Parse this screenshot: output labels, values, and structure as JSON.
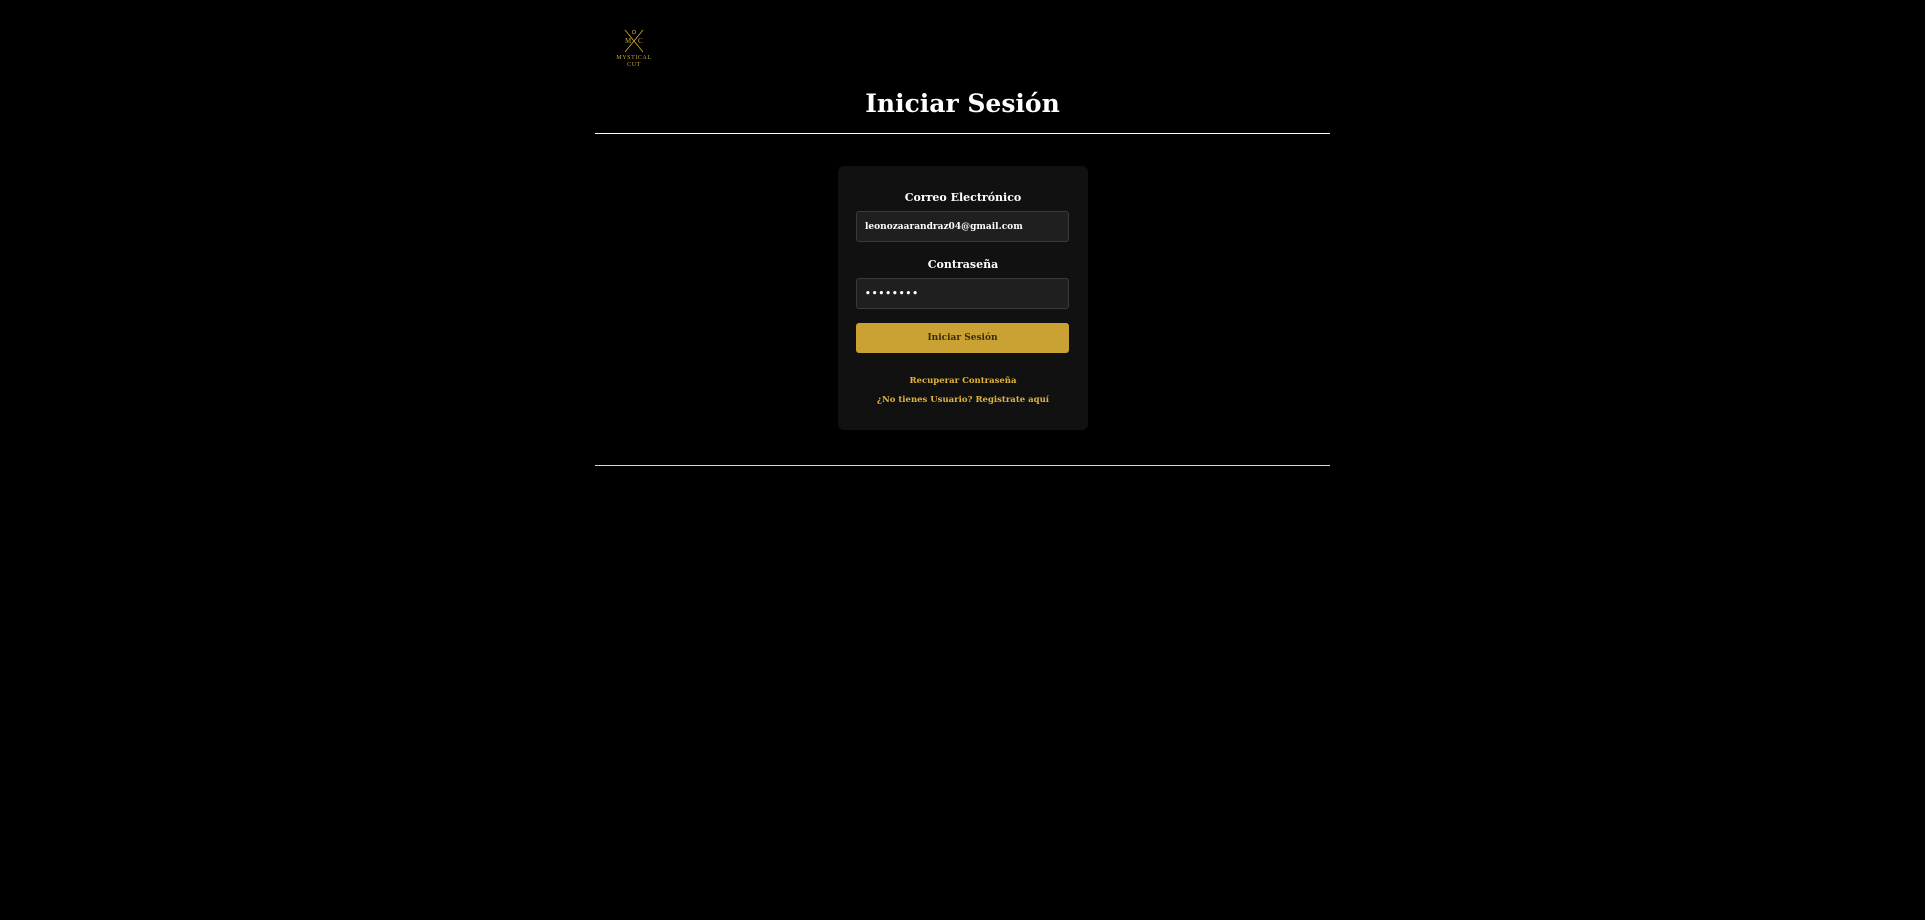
{
  "brand": {
    "logo_text": "MYSTICAL\nCUT",
    "logo_letters": "M C",
    "accent_color": "#c9a233"
  },
  "page": {
    "title": "Iniciar Sesión"
  },
  "form": {
    "email_label": "Correo Electrónico",
    "email_value": "leonozaarandraz04@gmail.com",
    "password_label": "Contraseña",
    "password_value": "********",
    "submit_label": "Iniciar Sesión",
    "recover_link": "Recuperar Contraseña",
    "register_link": "¿No tienes Usuario? Registrate aquí"
  }
}
